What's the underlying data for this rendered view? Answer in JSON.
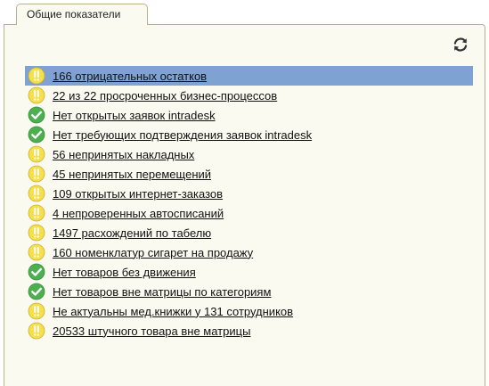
{
  "tab": {
    "label": "Общие показатели"
  },
  "toolbar": {
    "refresh_icon": "refresh-icon"
  },
  "colors": {
    "panel_bg": "#fbfaf0",
    "border": "#b9b08c",
    "selected_bg": "#7ea3d2",
    "warning": "#f5df4d",
    "ok": "#4caf50"
  },
  "indicators": [
    {
      "text": "166 отрицательных остатков",
      "status": "warning",
      "selected": true
    },
    {
      "text": "22 из 22 просроченных бизнес-процессов",
      "status": "warning",
      "selected": false
    },
    {
      "text": "Нет открытых заявок intradesk",
      "status": "ok",
      "selected": false
    },
    {
      "text": "Нет требующих подтверждения заявок intradesk",
      "status": "ok",
      "selected": false
    },
    {
      "text": "56 непринятых накладных",
      "status": "warning",
      "selected": false
    },
    {
      "text": "45 непринятых перемещений",
      "status": "warning",
      "selected": false
    },
    {
      "text": "109 открытых интернет-заказов",
      "status": "warning",
      "selected": false
    },
    {
      "text": "4 непроверенных автосписаний",
      "status": "warning",
      "selected": false
    },
    {
      "text": "1497 расхождений по табелю",
      "status": "warning",
      "selected": false
    },
    {
      "text": "160 номенклатур сигарет на продажу",
      "status": "warning",
      "selected": false
    },
    {
      "text": "Нет товаров без движения",
      "status": "ok",
      "selected": false
    },
    {
      "text": "Нет товаров вне матрицы по категориям",
      "status": "ok",
      "selected": false
    },
    {
      "text": "Не актуальны мед.книжки у 131 сотрудников",
      "status": "warning",
      "selected": false
    },
    {
      "text": "20533 штучного товара вне матрицы",
      "status": "warning",
      "selected": false
    }
  ]
}
